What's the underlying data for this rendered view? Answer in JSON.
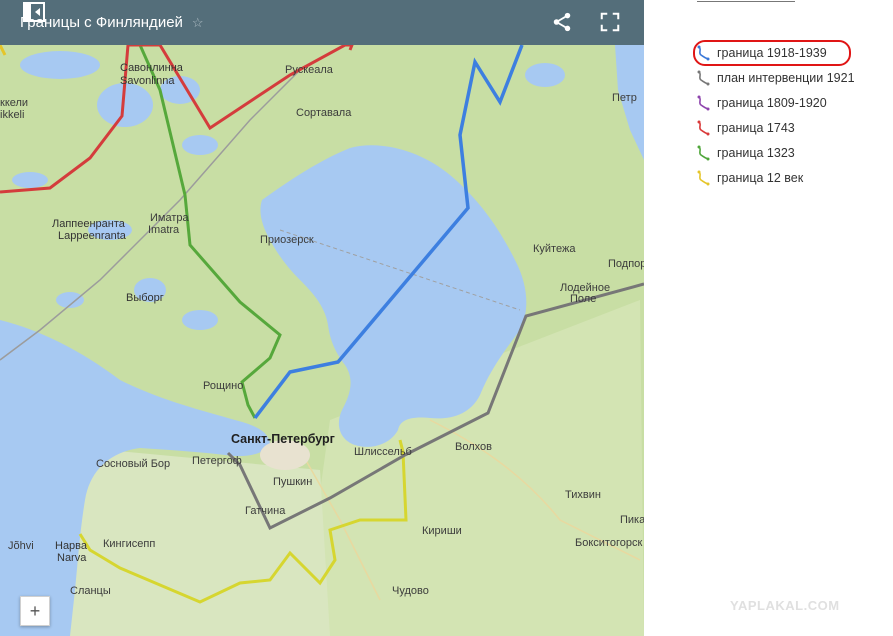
{
  "header": {
    "title": "Границы с Финляндией"
  },
  "legend": [
    {
      "label": "граница 1918-1939",
      "color": "#3a78d8"
    },
    {
      "label": "план интервенции 1921",
      "color": "#777777"
    },
    {
      "label": "граница 1809-1920",
      "color": "#8e44ad"
    },
    {
      "label": "граница 1743",
      "color": "#d93a3a"
    },
    {
      "label": "граница 1323",
      "color": "#4fa63a"
    },
    {
      "label": "граница 12 век",
      "color": "#e5c52a"
    }
  ],
  "map_labels": {
    "savonlinna": "Савонлинна",
    "savonlinna_fi": "Savonlinna",
    "ruskeala": "Рускеала",
    "kkeli": "ккели",
    "ikkeli": "ikkeli",
    "sortavala": "Сортавала",
    "petr": "Петр",
    "lappeenranta": "Лаппеенранта",
    "lappeenranta_fi": "Lappeenranta",
    "imatra": "Иматра",
    "imatra_fi": "Imatra",
    "priozersk": "Приозерск",
    "kuitezha": "Куйтежа",
    "podpor": "Подпор",
    "lodeinoe": "Лодейное",
    "pole": "Поле",
    "vyborg": "Выборг",
    "roshchino": "Рощино",
    "spb": "Санкт-Петербург",
    "shlisselburg": "Шлиссельб",
    "volkhov": "Волхов",
    "sosnovy_bor": "Сосновый Бор",
    "petergof": "Петергоф",
    "pushkin": "Пушкин",
    "tikhvin": "Тихвин",
    "gatchina": "Гатчина",
    "kirishi": "Кириши",
    "pikal": "Пикал",
    "narva": "Нарва",
    "narva_fi": "Narva",
    "johvi": "Jõhvi",
    "kingisepp": "Кингисепп",
    "boksitogorsk": "Бокситогорск",
    "slantsy": "Сланцы",
    "chudovo": "Чудово"
  },
  "zoom_in": "+",
  "watermark": "YAPLAKAL.COM"
}
